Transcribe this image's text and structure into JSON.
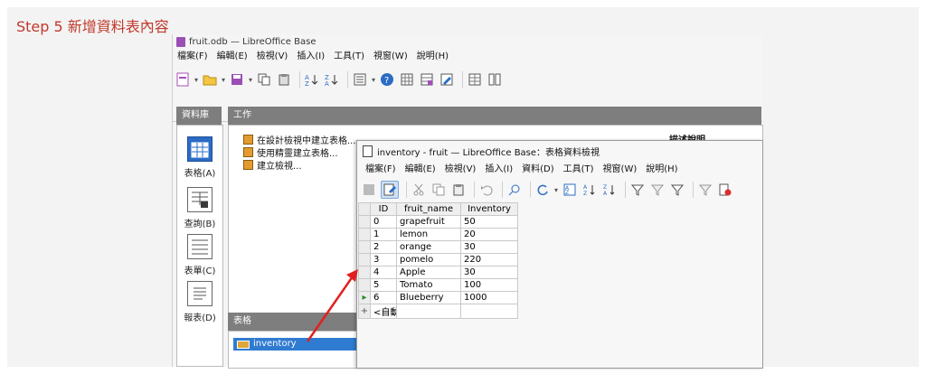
{
  "step_title": "Step 5 新增資料表內容",
  "window": {
    "title": "fruit.odb — LibreOffice Base",
    "menu": [
      "檔案(F)",
      "編輯(E)",
      "檢視(V)",
      "插入(I)",
      "工具(T)",
      "視窗(W)",
      "說明(H)"
    ]
  },
  "sidebar": {
    "header": "資料庫",
    "items": [
      {
        "label": "表格(A)",
        "icon": "table-icon",
        "active": true
      },
      {
        "label": "查詢(B)",
        "icon": "query-icon",
        "active": false
      },
      {
        "label": "表單(C)",
        "icon": "form-icon",
        "active": false
      },
      {
        "label": "報表(D)",
        "icon": "report-icon",
        "active": false
      }
    ]
  },
  "tasks": {
    "header": "工作",
    "items": [
      "在設計檢視中建立表格...",
      "使用精靈建立表格...",
      "建立檢視..."
    ],
    "description_label": "描述說明"
  },
  "tables_panel": {
    "header": "表格",
    "items": [
      "inventory"
    ]
  },
  "table_view": {
    "title": "inventory - fruit — LibreOffice Base：表格資料檢視",
    "menu": [
      "檔案(F)",
      "編輯(E)",
      "檢視(V)",
      "插入(I)",
      "資料(D)",
      "工具(T)",
      "視窗(W)",
      "說明(H)"
    ],
    "columns": [
      "ID",
      "fruit_name",
      "Inventory"
    ],
    "rows": [
      [
        "0",
        "grapefruit",
        "50"
      ],
      [
        "1",
        "lemon",
        "20"
      ],
      [
        "2",
        "orange",
        "30"
      ],
      [
        "3",
        "pomelo",
        "220"
      ],
      [
        "4",
        "Apple",
        "30"
      ],
      [
        "5",
        "Tomato",
        "100"
      ],
      [
        "6",
        "Blueberry",
        "1000"
      ]
    ],
    "new_row_label": "<自動"
  },
  "colors": {
    "accent": "#2f7bd1",
    "annotation_red": "#e02020",
    "step_red": "#c0392b"
  }
}
